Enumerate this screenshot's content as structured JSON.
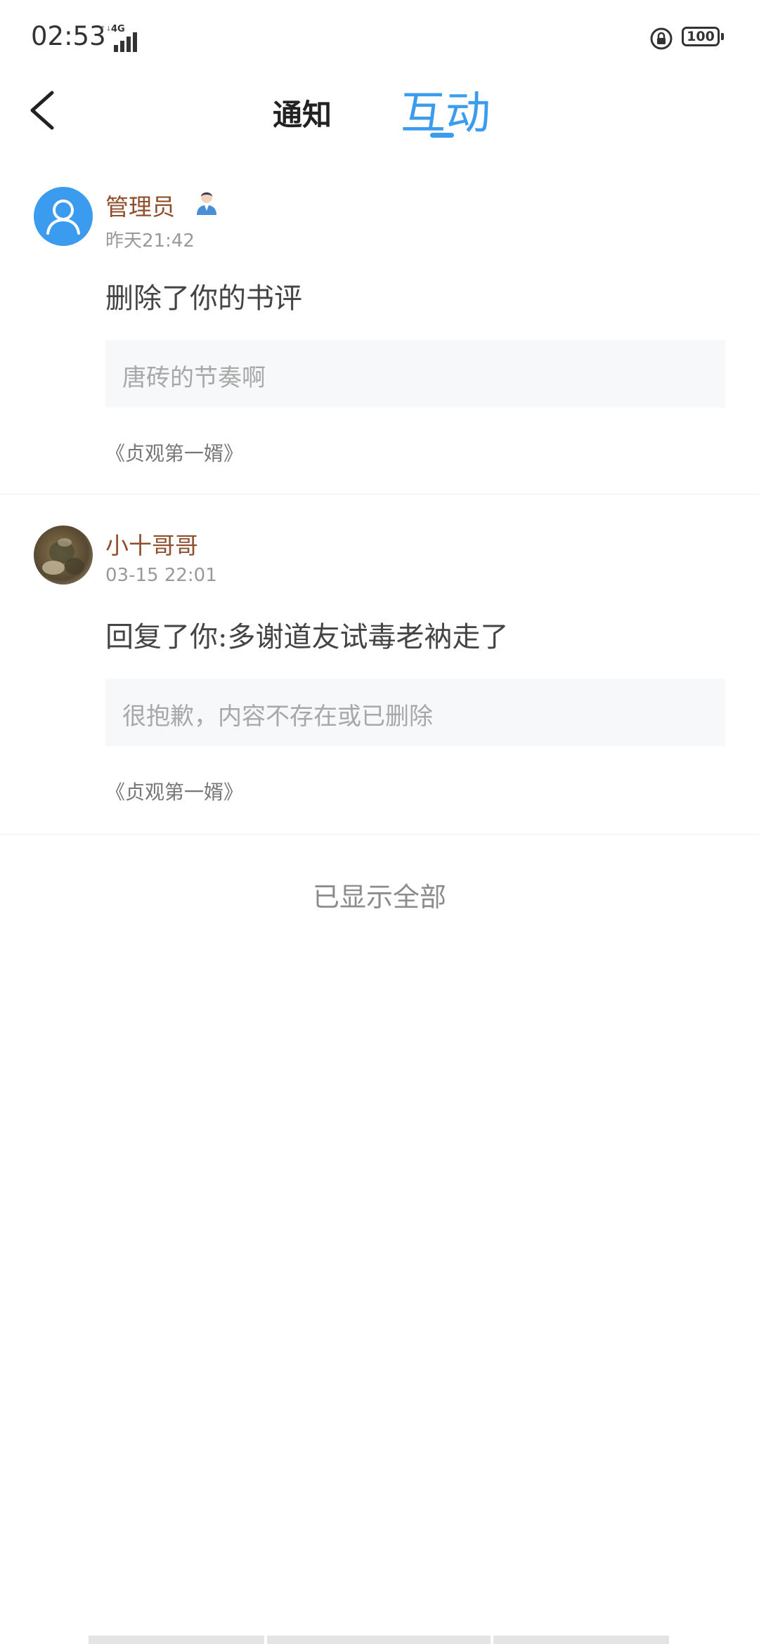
{
  "status_bar": {
    "time": "02:53",
    "network": "4G",
    "battery": "100",
    "icons": [
      "signal-icon",
      "lock-rotation-icon",
      "battery-icon"
    ]
  },
  "header": {
    "back_icon": "chevron-left-icon",
    "tabs": [
      {
        "label": "通知",
        "active": false
      },
      {
        "label": "互动",
        "active": true
      }
    ]
  },
  "notifications": [
    {
      "username": "管理员",
      "badge_icon": "admin-person-icon",
      "avatar_icon": "default-user-avatar",
      "time": "昨天21:42",
      "action": "删除了你的书评",
      "quote": "唐砖的节奏啊",
      "book": "《贞观第一婿》"
    },
    {
      "username": "小十哥哥",
      "avatar_icon": "user-photo-avatar",
      "time": "03-15 22:01",
      "action": "回复了你:多谢道友试毒老衲走了",
      "quote": "很抱歉，内容不存在或已删除",
      "book": "《贞观第一婿》"
    }
  ],
  "footer": {
    "end_text": "已显示全部"
  },
  "colors": {
    "accent": "#3a9bef",
    "username": "#8f4f2d",
    "muted": "#999999",
    "quote_bg": "#f7f8f9"
  }
}
